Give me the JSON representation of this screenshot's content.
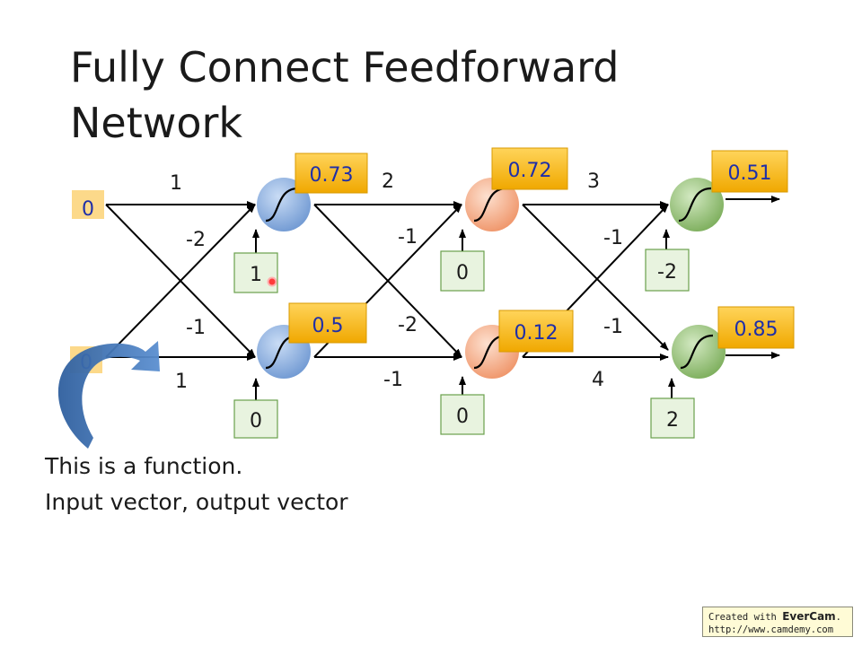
{
  "title": {
    "line1": "Fully Connect Feedforward",
    "line2": "Network"
  },
  "inputs": [
    "0",
    "0"
  ],
  "weights": {
    "l1": {
      "top_top": "1",
      "top_bottom": "-2",
      "bottom_top": "-1",
      "bottom_bottom": "1"
    },
    "l2": {
      "top_top": "2",
      "top_bottom": "-1",
      "bottom_top": "-2",
      "bottom_bottom": "-1"
    },
    "l3": {
      "top_top": "3",
      "top_bottom": "-1",
      "bottom_top": "-1",
      "bottom_bottom": "4"
    }
  },
  "biases": {
    "l1": [
      "1",
      "0"
    ],
    "l2": [
      "0",
      "0"
    ],
    "l3": [
      "-2",
      "2"
    ]
  },
  "outputs": {
    "l1": [
      "0.73",
      "0.5"
    ],
    "l2": [
      "0.72",
      "0.12"
    ],
    "l3": [
      "0.51",
      "0.85"
    ]
  },
  "caption": {
    "line1": "This is a function.",
    "line2": "Input vector, output vector"
  },
  "watermark": {
    "prefix": "Created with ",
    "brand": "EverCam",
    "suffix": ".",
    "url": "http://www.camdemy.com"
  },
  "colors": {
    "layer1_neuron": "#7ea6dc",
    "layer2_neuron": "#f4a582",
    "layer3_neuron": "#8dbb6f",
    "output_box": "#f5b400",
    "output_text": "#1f2fa8",
    "bias_box": "#e8f3df",
    "input_box": "#fcd98a",
    "arrow_callout": "#3d6fae"
  }
}
